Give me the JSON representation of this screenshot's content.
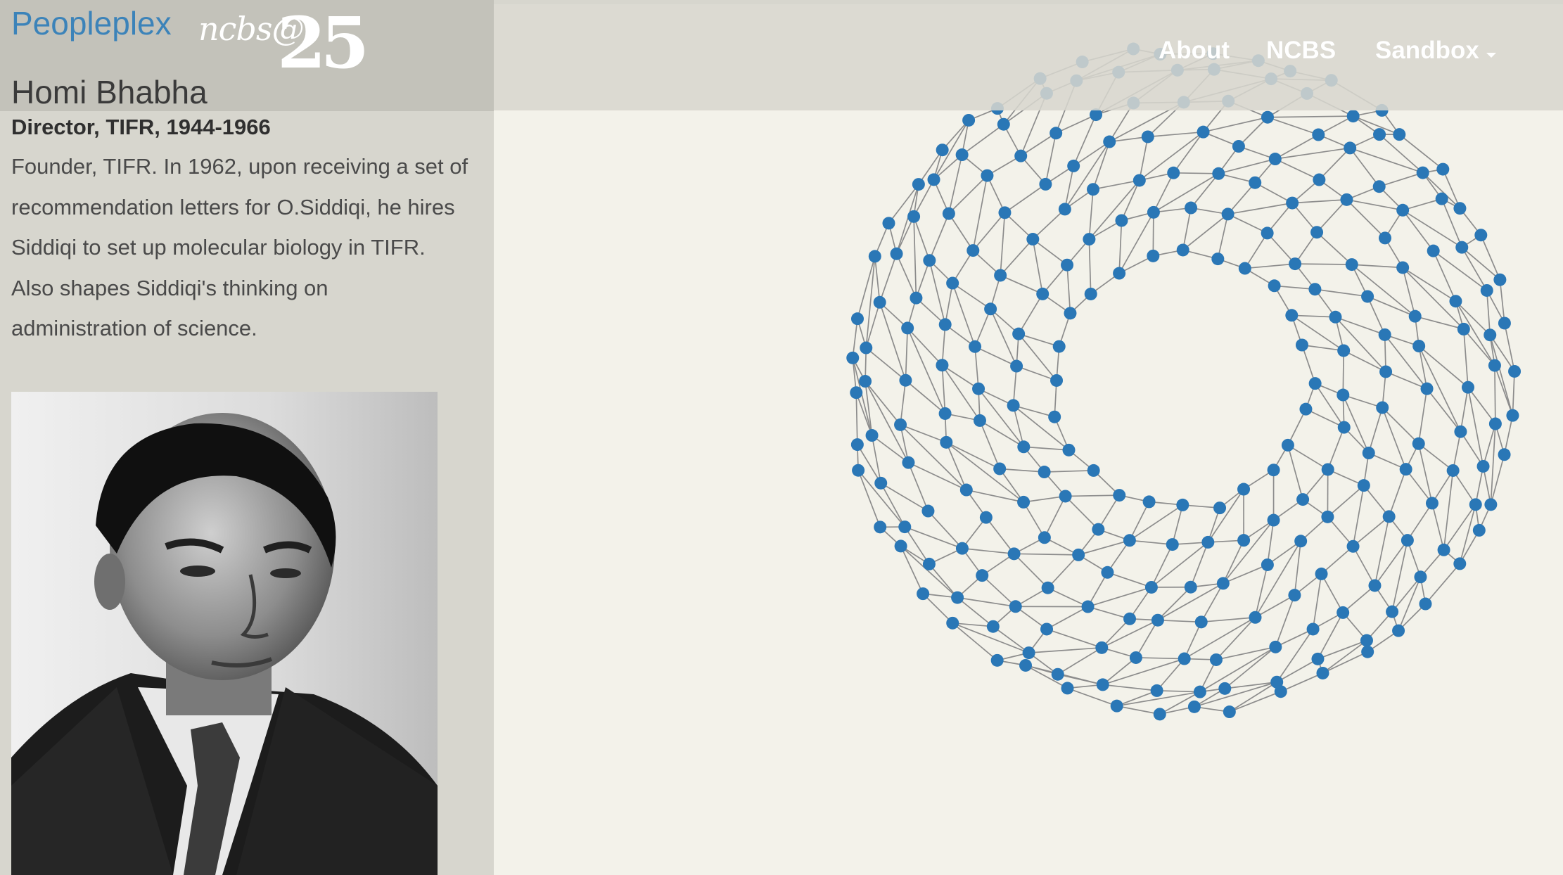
{
  "header": {
    "brand": "Peopleplex",
    "logo_text": "ncbs@",
    "logo_number": "25"
  },
  "nav": {
    "items": [
      "About",
      "NCBS",
      "Sandbox"
    ]
  },
  "profile": {
    "name": "Homi Bhabha",
    "role": "Director, TIFR, 1944-1966",
    "bio": "Founder, TIFR. In 1962, upon receiving a set of recommendation letters for O.Siddiqi, he hires Siddiqi to set up molecular biology in TIFR. Also shapes Siddiqi's thinking on administration of science.",
    "photo_icon": "portrait-photo"
  },
  "graph": {
    "node_color": "#2a77b6",
    "edge_color": "#8c8c8c",
    "shape": "ring"
  },
  "colors": {
    "brand": "#3c83b9",
    "sidebar": "#d7d6ce",
    "canvas": "#f3f2ea"
  }
}
